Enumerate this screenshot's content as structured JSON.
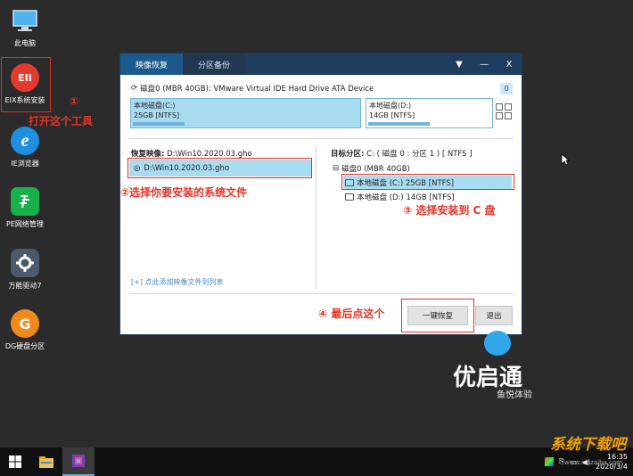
{
  "desktop": {
    "icons": [
      {
        "label": "此电脑"
      },
      {
        "label": "EIX系统安装",
        "glyph": "EII"
      },
      {
        "label": "IE浏览器",
        "glyph": "e"
      },
      {
        "label": "PE网络管理"
      },
      {
        "label": "万能驱动7"
      },
      {
        "label": "DG硬盘分区",
        "glyph": "G"
      }
    ]
  },
  "annotations": {
    "step1_num": "①",
    "step1_text": "打开这个工具",
    "step2_text": "②选择你要安装的系统文件",
    "step3_text": "③ 选择安装到 C 盘",
    "step4_text": "④ 最后点这个"
  },
  "dialog": {
    "tabs": {
      "restore": "映像恢复",
      "backup": "分区备份"
    },
    "window_buttons": {
      "menu": "▼",
      "minimize": "—",
      "close": "X"
    },
    "disk_header": "磁盘0 (MBR 40GB): VMware Virtual IDE Hard Drive ATA Device",
    "disk_count": "0",
    "partitions": {
      "c": {
        "name": "本地磁盘(C:)",
        "size": "25GB [NTFS]",
        "used_fraction": 0.24
      },
      "d": {
        "name": "本地磁盘(D:)",
        "size": "14GB [NTFS]",
        "used_fraction": 0.52
      }
    },
    "image_label": "恢复映像:",
    "image_path": "D:\\Win10.2020.03.gho",
    "image_file": "D:\\Win10.2020.03.gho",
    "add_link": "[+] 点此添加映像文件到列表",
    "target_label": "目标分区:",
    "target_value": "C: ( 磁盘 0 : 分区 1 ) [ NTFS ]",
    "tree_root": "磁盘0 (MBR 40GB)",
    "tree_items": [
      {
        "label": "本地磁盘 (C:) 25GB [NTFS]"
      },
      {
        "label": "本地磁盘 (D:) 14GB [NTFS]"
      }
    ],
    "buttons": {
      "restore": "一键恢复",
      "exit": "退出"
    }
  },
  "brand": {
    "name": "优启通",
    "tagline": "鱼悦体验"
  },
  "taskbar": {
    "time": "16:35",
    "date": "2020/3/4"
  },
  "watermark": {
    "title": "系统下载吧",
    "url": "www.xiazaiba.com"
  },
  "colors": {
    "desktop_bg": "#2b2b2b",
    "titlebar": "#1e3c5e",
    "selection": "#a8dcf1",
    "annotation_red": "#e53427"
  }
}
